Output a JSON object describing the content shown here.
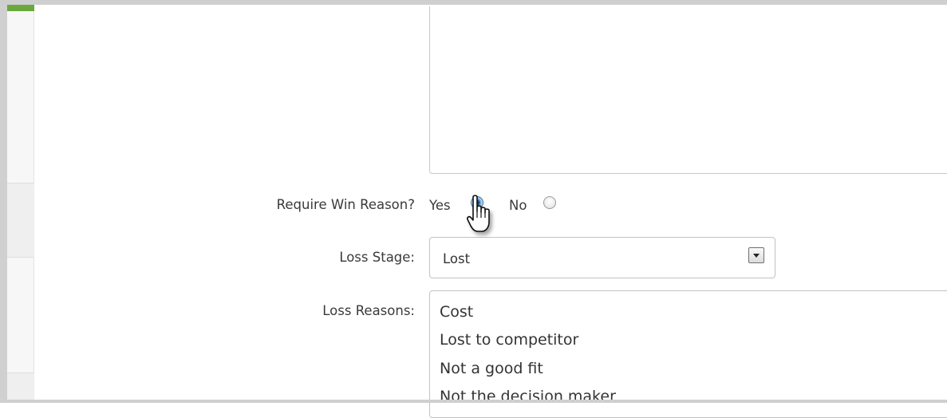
{
  "form": {
    "require_win_reason": {
      "label": "Require Win Reason?",
      "yes_label": "Yes",
      "no_label": "No",
      "selected": "Yes"
    },
    "loss_stage": {
      "label": "Loss Stage:",
      "value": "Lost"
    },
    "loss_reasons": {
      "label": "Loss Reasons:",
      "lines": [
        "Cost",
        "Lost to competitor",
        "Not a good fit",
        "Not the decision maker"
      ]
    }
  },
  "colors": {
    "accent_green": "#6aa83c",
    "radio_selected": "#1f5fa8"
  },
  "icons": {
    "cursor": "hand-pointer-icon",
    "dropdown": "dropdown-arrow-icon"
  }
}
